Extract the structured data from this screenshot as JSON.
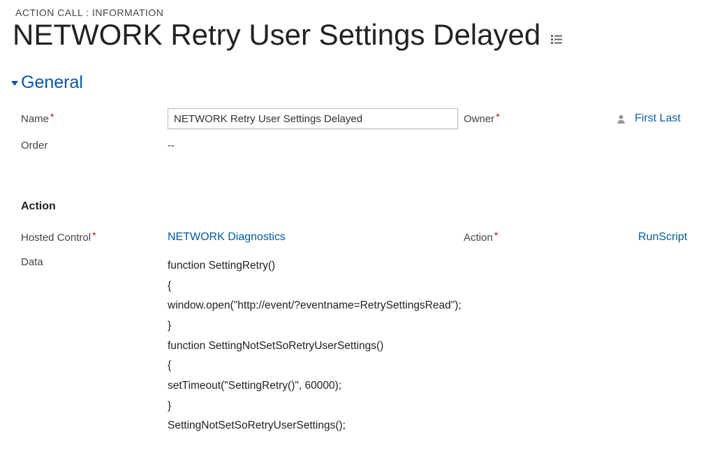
{
  "breadcrumb": "ACTION CALL : INFORMATION",
  "title": "NETWORK Retry User Settings Delayed",
  "section": {
    "title": "General"
  },
  "labels": {
    "name": "Name",
    "order": "Order",
    "owner": "Owner",
    "hosted_control": "Hosted Control",
    "action": "Action",
    "data": "Data"
  },
  "action_heading": "Action",
  "values": {
    "name": "NETWORK Retry User Settings Delayed",
    "order": "--",
    "owner": "First Last",
    "hosted_control": "NETWORK Diagnostics",
    "action": "RunScript",
    "data": "function SettingRetry()\n{\nwindow.open(\"http://event/?eventname=RetrySettingsRead\");\n}\nfunction SettingNotSetSoRetryUserSettings()\n{\nsetTimeout(\"SettingRetry()\", 60000);\n}\nSettingNotSetSoRetryUserSettings();"
  }
}
